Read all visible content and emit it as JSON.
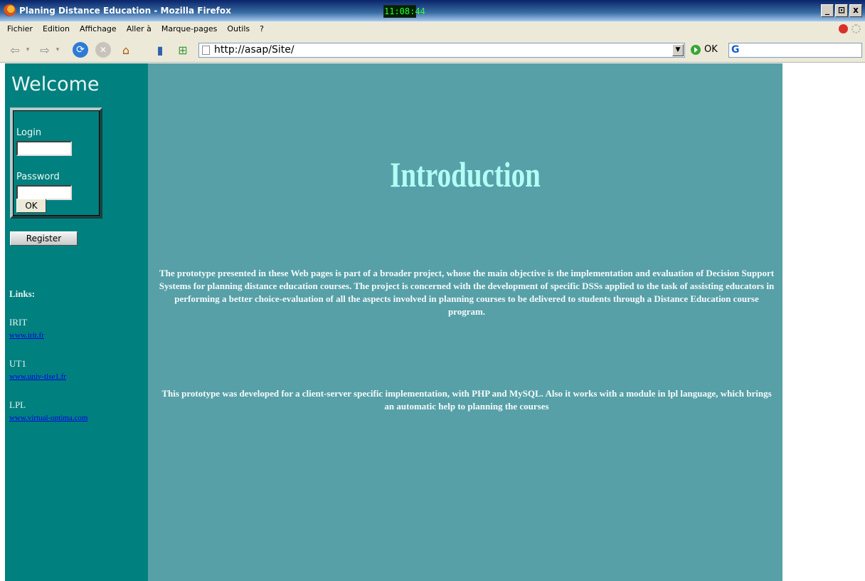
{
  "window": {
    "title": "Planing Distance Education - Mozilla Firefox",
    "clock": "11:08:44",
    "controls": [
      "_",
      "⊡",
      "x"
    ]
  },
  "menu": [
    "Fichier",
    "Edition",
    "Affichage",
    "Aller à",
    "Marque-pages",
    "Outils",
    "?"
  ],
  "toolbar": {
    "url": "http://asap/Site/",
    "go_label": "OK",
    "search_placeholder": ""
  },
  "sidebar": {
    "welcome": "Welcome",
    "login_label": "Login",
    "password_label": "Password",
    "ok_label": "OK",
    "register_label": "Register",
    "links_heading": "Links:",
    "links": [
      {
        "name": "IRIT",
        "url": "www.irit.fr"
      },
      {
        "name": "UT1",
        "url": "www.univ-tlse1.fr"
      },
      {
        "name": "LPL",
        "url": "www.virtual-optima.com"
      }
    ]
  },
  "main": {
    "title": "Introduction",
    "paragraph1": "The prototype presented in these Web pages is part of a broader project, whose the main objective is the implementation and evaluation of Decision Support Systems for planning distance education courses. The project is concerned with the development of specific DSSs applied to the task of assisting educators in performing a better choice-evaluation of all the aspects involved in planning courses to be delivered to students through a Distance Education course program.",
    "paragraph2": "This prototype was developed for a client-server specific implementation, with PHP and MySQL. Also it works with a module in lpl language, which brings an automatic help to planning the courses"
  }
}
